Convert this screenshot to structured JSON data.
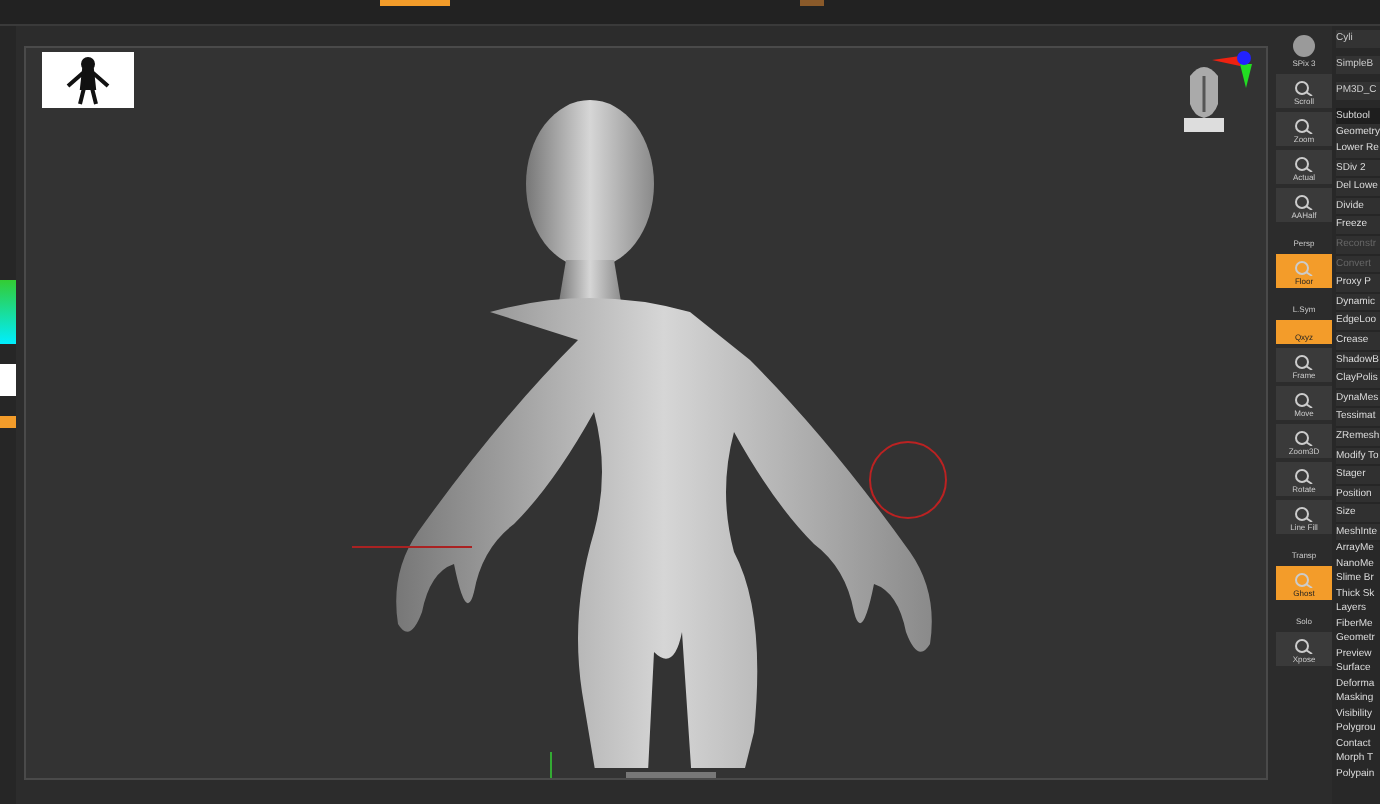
{
  "shelf": [
    {
      "label": "SPix 3",
      "kind": "sphere",
      "selected": false
    },
    {
      "label": "Scroll",
      "kind": "tool",
      "selected": false
    },
    {
      "label": "Zoom",
      "kind": "tool",
      "selected": false
    },
    {
      "label": "Actual",
      "kind": "tool",
      "selected": false
    },
    {
      "label": "AAHalf",
      "kind": "tool",
      "selected": false
    },
    {
      "label": "Persp",
      "kind": "small",
      "selected": false
    },
    {
      "label": "Floor",
      "kind": "tool",
      "selected": true
    },
    {
      "label": "L.Sym",
      "kind": "small",
      "selected": false
    },
    {
      "label": "Qxyz",
      "kind": "small",
      "selected": true
    },
    {
      "label": "Frame",
      "kind": "tool",
      "selected": false
    },
    {
      "label": "Move",
      "kind": "tool",
      "selected": false
    },
    {
      "label": "Zoom3D",
      "kind": "tool",
      "selected": false
    },
    {
      "label": "Rotate",
      "kind": "tool",
      "selected": false
    },
    {
      "label": "Line Fill",
      "kind": "tool",
      "selected": false
    },
    {
      "label": "Transp",
      "kind": "small",
      "selected": false
    },
    {
      "label": "Ghost",
      "kind": "tool",
      "selected": true
    },
    {
      "label": "Solo",
      "kind": "small",
      "selected": false
    },
    {
      "label": "Xpose",
      "kind": "tool",
      "selected": false
    }
  ],
  "tool_thumbs": [
    {
      "label": "Cyli"
    },
    {
      "label": "SimpleB"
    },
    {
      "label": "PM3D_C"
    }
  ],
  "subtool": {
    "title": "Subtool",
    "section": "Geometry",
    "items": [
      {
        "label": "Lower Re",
        "disabled": false
      },
      {
        "label": "SDiv 2",
        "disabled": false
      },
      {
        "label": "Del Lowe",
        "disabled": false
      },
      {
        "label": "Divide",
        "disabled": false
      },
      {
        "label": "Freeze",
        "disabled": false
      },
      {
        "label": "Reconstr",
        "disabled": true
      },
      {
        "label": "Convert",
        "disabled": true
      },
      {
        "label": "Proxy P",
        "disabled": false
      },
      {
        "label": "Dynamic",
        "disabled": false
      },
      {
        "label": "EdgeLoo",
        "disabled": false
      },
      {
        "label": "Crease",
        "disabled": false
      },
      {
        "label": "ShadowB",
        "disabled": false
      },
      {
        "label": "ClayPolis",
        "disabled": false
      },
      {
        "label": "DynaMes",
        "disabled": false
      },
      {
        "label": "Tessimat",
        "disabled": false
      },
      {
        "label": "ZRemesh",
        "disabled": false
      },
      {
        "label": "Modify To",
        "disabled": false
      },
      {
        "label": "Stager",
        "disabled": false
      },
      {
        "label": "Position",
        "disabled": false
      },
      {
        "label": "Size",
        "disabled": false
      },
      {
        "label": "MeshInte",
        "disabled": false
      }
    ]
  },
  "palettes": [
    "ArrayMe",
    "NanoMe",
    "Slime Br",
    "Thick Sk",
    "Layers",
    "FiberMe",
    "Geometr",
    "Preview",
    "Surface",
    "Deforma",
    "Masking",
    "Visibility",
    "Polygrou",
    "Contact",
    "Morph T",
    "Polypain"
  ]
}
